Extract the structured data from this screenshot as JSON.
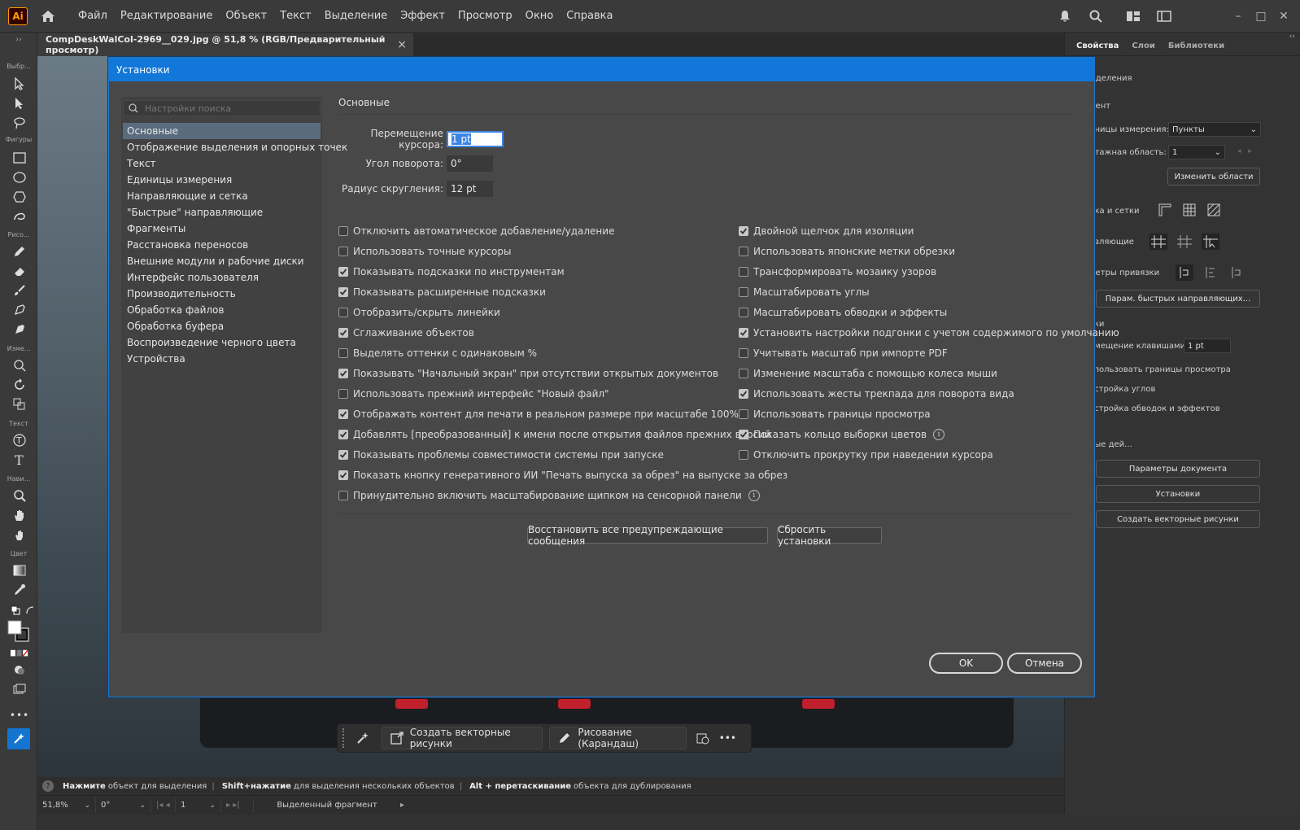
{
  "menubar": {
    "logo": "Ai",
    "items": [
      "Файл",
      "Редактирование",
      "Объект",
      "Текст",
      "Выделение",
      "Эффект",
      "Просмотр",
      "Окно",
      "Справка"
    ]
  },
  "document": {
    "tab_title": "CompDeskWalCol-2969__029.jpg @ 51,8 % (RGB/Предварительный просмотр)",
    "close": "×"
  },
  "toolbar": {
    "labels": [
      "Выбр...",
      "Фигуры",
      "Рисо...",
      "Изме...",
      "Текст",
      "Нави...",
      "Цвет"
    ]
  },
  "right_panel": {
    "tabs": [
      "Свойства",
      "Слои",
      "Библиотеки"
    ],
    "rows": {
      "selection": "ыделения",
      "element": "мент",
      "units_label": "иницы измерения:",
      "units_value": "Пункты",
      "artboard_label": "нтажная область:",
      "artboard_value": "1",
      "edit_artboards": "Изменить области",
      "grids": "йка и сетки",
      "guides": "авляющие",
      "snap": "метры привязки",
      "smart_guides_btn": "Парам. быстрых направляющих...",
      "prefs_section": "вки",
      "keyboard_increment_label": "емещение клавишами:",
      "keyboard_increment_value": "1 pt",
      "preview_bounds": "спользовать границы просмотра",
      "scale_corners": "астройка углов",
      "scale_strokes": "астройка обводок и эффектов",
      "quick_actions": "рые дей...",
      "doc_setup": "Параметры документа",
      "preferences": "Установки",
      "create_vectors": "Создать векторные рисунки"
    }
  },
  "floating_bar": {
    "create_vectors": "Создать векторные рисунки",
    "pencil": "Рисование (Карандаш)",
    "more": "•••"
  },
  "status": {
    "hint_bold1": "Нажмите",
    "hint_text1": "объект для выделения",
    "hint_bold2": "Shift+нажатие",
    "hint_text2": "для выделения нескольких объектов",
    "hint_bold3": "Alt + перетаскивание",
    "hint_text3": "объекта для дублирования",
    "zoom": "51,8%",
    "rotation": "0°",
    "artboard": "1",
    "selection": "Выделенный фрагмент"
  },
  "dialog": {
    "title": "Установки",
    "search_placeholder": "Настройки поиска",
    "nav": [
      "Основные",
      "Отображение выделения и опорных точек",
      "Текст",
      "Единицы измерения",
      "Направляющие и сетка",
      "\"Быстрые\" направляющие",
      "Фрагменты",
      "Расстановка переносов",
      "Внешние модули и рабочие диски",
      "Интерфейс пользователя",
      "Производительность",
      "Обработка файлов",
      "Обработка буфера",
      "Воспроизведение черного цвета",
      "Устройства"
    ],
    "section_title": "Основные",
    "fields": {
      "keyboard_increment_label": "Перемещение курсора:",
      "keyboard_increment_value": "1 pt",
      "constrain_angle_label": "Угол поворота:",
      "constrain_angle_value": "0°",
      "corner_radius_label": "Радиус скругления:",
      "corner_radius_value": "12 pt"
    },
    "left_checks": [
      {
        "label": "Отключить автоматическое добавление/удаление",
        "checked": false
      },
      {
        "label": "Использовать точные курсоры",
        "checked": false
      },
      {
        "label": "Показывать подсказки по инструментам",
        "checked": true
      },
      {
        "label": "Показывать расширенные подсказки",
        "checked": true
      },
      {
        "label": "Отобразить/скрыть линейки",
        "checked": false
      },
      {
        "label": "Сглаживание объектов",
        "checked": true
      },
      {
        "label": "Выделять оттенки с одинаковым %",
        "checked": false
      },
      {
        "label": "Показывать \"Начальный экран\" при отсутствии открытых документов",
        "checked": true
      },
      {
        "label": "Использовать прежний интерфейс \"Новый файл\"",
        "checked": false
      },
      {
        "label": "Отображать контент для печати в реальном размере при масштабе 100%",
        "checked": true
      },
      {
        "label": "Добавлять [преобразованный] к имени после открытия файлов прежних версий",
        "checked": true
      },
      {
        "label": "Показывать проблемы совместимости системы при запуске",
        "checked": true
      },
      {
        "label": "Показать кнопку генеративного ИИ \"Печать выпуска за обрез\" на выпуске за обрез",
        "checked": true
      },
      {
        "label": "Принудительно включить масштабирование щипком на сенсорной панели",
        "checked": false
      }
    ],
    "right_checks": [
      {
        "label": "Двойной щелчок для изоляции",
        "checked": true
      },
      {
        "label": "Использовать японские метки обрезки",
        "checked": false
      },
      {
        "label": "Трансформировать мозаику узоров",
        "checked": false
      },
      {
        "label": "Масштабировать углы",
        "checked": false
      },
      {
        "label": "Масштабировать обводки и эффекты",
        "checked": false
      },
      {
        "label": "Установить настройки подгонки с учетом содержимого по умолчанию",
        "checked": true
      },
      {
        "label": "Учитывать масштаб при импорте PDF",
        "checked": false
      },
      {
        "label": "Изменение масштаба с помощью колеса мыши",
        "checked": false
      },
      {
        "label": "Использовать жесты трекпада для поворота вида",
        "checked": true
      },
      {
        "label": "Использовать границы просмотра",
        "checked": false
      },
      {
        "label": "Показать кольцо выборки цветов",
        "checked": true
      },
      {
        "label": "Отключить прокрутку при наведении курсора",
        "checked": false
      }
    ],
    "reset_warnings": "Восстановить все предупреждающие сообщения",
    "reset_prefs": "Сбросить установки",
    "ok": "OK",
    "cancel": "Отмена",
    "info_glyph": "i"
  }
}
